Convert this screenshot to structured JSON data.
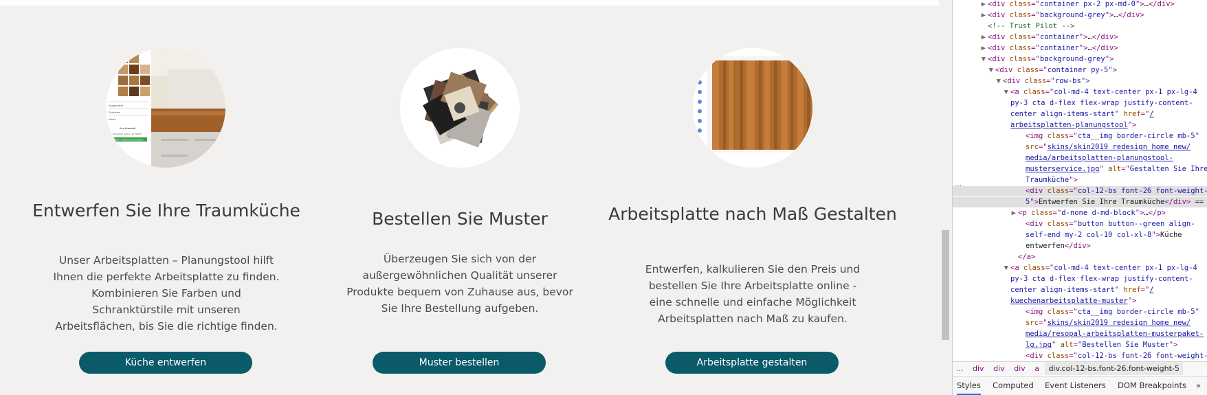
{
  "cards": [
    {
      "title": "Entwerfen Sie Ihre Traumküche",
      "description": "Unser Arbeitsplatten – Planungstool hilft Ihnen die perfekte Arbeitsplatte zu finden. Kombinieren Sie Farben und Schranktürstile mit unseren Arbeitsflächen, bis Sie die richtige finden.",
      "button": "Küche entwerfen",
      "image_alt": "Gestalten Sie Ihre Traumküche",
      "image_ui": {
        "rows": [
          "Ausgewählt",
          "Schränke",
          "Wand"
        ],
        "label": "Ihre Auswahl:",
        "detail": "Massivholz · Eiche · ab 79,00 €",
        "cta": "Weiter in Warenkorb hinzufügen"
      }
    },
    {
      "title": "Bestellen Sie Muster",
      "description": "Überzeugen Sie sich von der außergewöhnlichen Qualität unserer Produkte bequem von Zuhause aus, bevor Sie Ihre Bestellung aufgeben.",
      "button": "Muster bestellen",
      "image_alt": "Bestellen Sie Muster"
    },
    {
      "title": "Arbeitsplatte nach Maß Gestalten",
      "description": "Entwerfen, kalkulieren Sie den Preis und bestellen Sie Ihre Arbeitsplatte online - eine schnelle und einfache Möglichkeit Arbeitsplatten nach Maß zu kaufen.",
      "button": "Arbeitsplatte gestalten",
      "image_alt": "Arbeitsplatte nach Maß Gestalten"
    }
  ],
  "devtools": {
    "breadcrumbs": [
      "...",
      "div",
      "div",
      "div",
      "a",
      "div.col-12-bs.font-26.font-weight-5"
    ],
    "tabs": [
      "Styles",
      "Computed",
      "Event Listeners",
      "DOM Breakpoints",
      "»"
    ],
    "lines": [
      {
        "indent": 3,
        "tri": "▶",
        "html": [
          [
            "tag",
            "<div "
          ],
          [
            "attr",
            "class"
          ],
          [
            "tag",
            "=\""
          ],
          [
            "val",
            "container px-2 px-md-0"
          ],
          [
            "tag",
            "\">"
          ],
          [
            "txt",
            "…"
          ],
          [
            "tag",
            "</div>"
          ]
        ]
      },
      {
        "indent": 3,
        "tri": "▶",
        "html": [
          [
            "tag",
            "<div "
          ],
          [
            "attr",
            "class"
          ],
          [
            "tag",
            "=\""
          ],
          [
            "val",
            "background-grey"
          ],
          [
            "tag",
            "\">"
          ],
          [
            "txt",
            "…"
          ],
          [
            "tag",
            "</div>"
          ]
        ]
      },
      {
        "indent": 3,
        "tri": "",
        "html": [
          [
            "cmt",
            "<!-- Trust Pilot -->"
          ]
        ]
      },
      {
        "indent": 3,
        "tri": "▶",
        "html": [
          [
            "tag",
            "<div "
          ],
          [
            "attr",
            "class"
          ],
          [
            "tag",
            "=\""
          ],
          [
            "val",
            "container"
          ],
          [
            "tag",
            "\">"
          ],
          [
            "txt",
            "…"
          ],
          [
            "tag",
            "</div>"
          ]
        ]
      },
      {
        "indent": 3,
        "tri": "▶",
        "html": [
          [
            "tag",
            "<div "
          ],
          [
            "attr",
            "class"
          ],
          [
            "tag",
            "=\""
          ],
          [
            "val",
            "container"
          ],
          [
            "tag",
            "\">"
          ],
          [
            "txt",
            "…"
          ],
          [
            "tag",
            "</div>"
          ]
        ]
      },
      {
        "indent": 3,
        "tri": "▼",
        "html": [
          [
            "tag",
            "<div "
          ],
          [
            "attr",
            "class"
          ],
          [
            "tag",
            "=\""
          ],
          [
            "val",
            "background-grey"
          ],
          [
            "tag",
            "\">"
          ]
        ]
      },
      {
        "indent": 4,
        "tri": "▼",
        "html": [
          [
            "tag",
            "<div "
          ],
          [
            "attr",
            "class"
          ],
          [
            "tag",
            "=\""
          ],
          [
            "val",
            "container py-5"
          ],
          [
            "tag",
            "\">"
          ]
        ]
      },
      {
        "indent": 5,
        "tri": "▼",
        "html": [
          [
            "tag",
            "<div "
          ],
          [
            "attr",
            "class"
          ],
          [
            "tag",
            "=\""
          ],
          [
            "val",
            "row-bs"
          ],
          [
            "tag",
            "\">"
          ]
        ]
      },
      {
        "indent": 6,
        "tri": "▼",
        "html": [
          [
            "tag",
            "<a "
          ],
          [
            "attr",
            "class"
          ],
          [
            "tag",
            "=\""
          ],
          [
            "val",
            "col-md-4 text-center px-1 px-lg-4"
          ]
        ]
      },
      {
        "indent": 6,
        "tri": "",
        "html": [
          [
            "val",
            "py-3 cta d-flex flex-wrap justify-content-"
          ]
        ]
      },
      {
        "indent": 6,
        "tri": "",
        "html": [
          [
            "val",
            "center align-items-start"
          ],
          [
            "tag",
            "\" "
          ],
          [
            "attr",
            "href"
          ],
          [
            "tag",
            "=\""
          ],
          [
            "link",
            "/"
          ]
        ]
      },
      {
        "indent": 6,
        "tri": "",
        "html": [
          [
            "link",
            "arbeitsplatten-planungstool"
          ],
          [
            "tag",
            "\">"
          ]
        ]
      },
      {
        "indent": 8,
        "tri": "",
        "html": [
          [
            "tag",
            "<img "
          ],
          [
            "attr",
            "class"
          ],
          [
            "tag",
            "=\""
          ],
          [
            "val",
            "cta__img border-circle mb-5"
          ],
          [
            "tag",
            "\""
          ]
        ]
      },
      {
        "indent": 8,
        "tri": "",
        "html": [
          [
            "attr",
            "src"
          ],
          [
            "tag",
            "=\""
          ],
          [
            "link",
            "skins/skin2019 redesign home new/"
          ]
        ]
      },
      {
        "indent": 8,
        "tri": "",
        "html": [
          [
            "link",
            "media/arbeitsplatten-planungstool-"
          ]
        ]
      },
      {
        "indent": 8,
        "tri": "",
        "html": [
          [
            "link",
            "musterservice.jpg"
          ],
          [
            "tag",
            "\" "
          ],
          [
            "attr",
            "alt"
          ],
          [
            "tag",
            "=\""
          ],
          [
            "val",
            "Gestalten Sie Ihre"
          ]
        ]
      },
      {
        "indent": 8,
        "tri": "",
        "html": [
          [
            "val",
            "Traumküche"
          ],
          [
            "tag",
            "\">"
          ]
        ]
      },
      {
        "indent": 8,
        "tri": "",
        "sel": true,
        "html": [
          [
            "tag",
            "<div "
          ],
          [
            "attr",
            "class"
          ],
          [
            "tag",
            "=\""
          ],
          [
            "val",
            "col-12-bs font-26 font-weight-"
          ]
        ]
      },
      {
        "indent": 8,
        "tri": "",
        "sel": true,
        "html": [
          [
            "val",
            "5"
          ],
          [
            "tag",
            "\">"
          ],
          [
            "txt",
            "Entwerfen Sie Ihre Traumküche"
          ],
          [
            "tag",
            "</div>"
          ],
          [
            "txt",
            " == $0"
          ]
        ]
      },
      {
        "indent": 7,
        "tri": "▶",
        "html": [
          [
            "tag",
            "<p "
          ],
          [
            "attr",
            "class"
          ],
          [
            "tag",
            "=\""
          ],
          [
            "val",
            "d-none d-md-block"
          ],
          [
            "tag",
            "\">"
          ],
          [
            "txt",
            "…"
          ],
          [
            "tag",
            "</p>"
          ]
        ]
      },
      {
        "indent": 8,
        "tri": "",
        "html": [
          [
            "tag",
            "<div "
          ],
          [
            "attr",
            "class"
          ],
          [
            "tag",
            "=\""
          ],
          [
            "val",
            "button button--green align-"
          ]
        ]
      },
      {
        "indent": 8,
        "tri": "",
        "html": [
          [
            "val",
            "self-end my-2 col-10 col-xl-8"
          ],
          [
            "tag",
            "\">"
          ],
          [
            "txt",
            "Küche"
          ]
        ]
      },
      {
        "indent": 8,
        "tri": "",
        "html": [
          [
            "txt",
            "entwerfen"
          ],
          [
            "tag",
            "</div>"
          ]
        ]
      },
      {
        "indent": 7,
        "tri": "",
        "html": [
          [
            "tag",
            "</a>"
          ]
        ]
      },
      {
        "indent": 6,
        "tri": "▼",
        "html": [
          [
            "tag",
            "<a "
          ],
          [
            "attr",
            "class"
          ],
          [
            "tag",
            "=\""
          ],
          [
            "val",
            "col-md-4 text-center px-1 px-lg-4"
          ]
        ]
      },
      {
        "indent": 6,
        "tri": "",
        "html": [
          [
            "val",
            "py-3 cta d-flex flex-wrap justify-content-"
          ]
        ]
      },
      {
        "indent": 6,
        "tri": "",
        "html": [
          [
            "val",
            "center align-items-start"
          ],
          [
            "tag",
            "\" "
          ],
          [
            "attr",
            "href"
          ],
          [
            "tag",
            "=\""
          ],
          [
            "link",
            "/"
          ]
        ]
      },
      {
        "indent": 6,
        "tri": "",
        "html": [
          [
            "link",
            "kuechenarbeitsplatte-muster"
          ],
          [
            "tag",
            "\">"
          ]
        ]
      },
      {
        "indent": 8,
        "tri": "",
        "html": [
          [
            "tag",
            "<img "
          ],
          [
            "attr",
            "class"
          ],
          [
            "tag",
            "=\""
          ],
          [
            "val",
            "cta__img border-circle mb-5"
          ],
          [
            "tag",
            "\""
          ]
        ]
      },
      {
        "indent": 8,
        "tri": "",
        "html": [
          [
            "attr",
            "src"
          ],
          [
            "tag",
            "=\""
          ],
          [
            "link",
            "skins/skin2019 redesign home new/"
          ]
        ]
      },
      {
        "indent": 8,
        "tri": "",
        "html": [
          [
            "link",
            "media/resopal-arbeitsplatten-musterpaket-"
          ]
        ]
      },
      {
        "indent": 8,
        "tri": "",
        "html": [
          [
            "link",
            "lg.jpg"
          ],
          [
            "tag",
            "\" "
          ],
          [
            "attr",
            "alt"
          ],
          [
            "tag",
            "=\""
          ],
          [
            "val",
            "Bestellen Sie Muster"
          ],
          [
            "tag",
            "\">"
          ]
        ]
      },
      {
        "indent": 8,
        "tri": "",
        "html": [
          [
            "tag",
            "<div "
          ],
          [
            "attr",
            "class"
          ],
          [
            "tag",
            "=\""
          ],
          [
            "val",
            "col-12-bs font-26 font-weight-"
          ]
        ]
      },
      {
        "indent": 8,
        "tri": "",
        "html": [
          [
            "val",
            "5"
          ],
          [
            "tag",
            "\">"
          ],
          [
            "txt",
            "Bestellen Sie Muster"
          ],
          [
            "tag",
            "</div>"
          ]
        ]
      }
    ],
    "selected_ellipsis": "..."
  }
}
